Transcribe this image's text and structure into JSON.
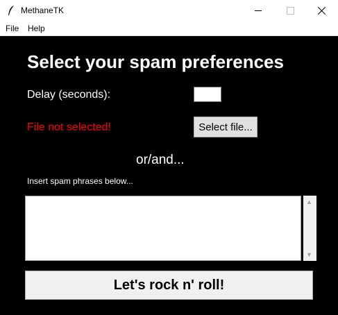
{
  "window": {
    "title": "MethaneTK"
  },
  "menu": {
    "items": [
      {
        "label": "File"
      },
      {
        "label": "Help"
      }
    ]
  },
  "main": {
    "heading": "Select your spam preferences",
    "delay_label": "Delay (seconds):",
    "delay_value": "",
    "file_status": "File not selected!",
    "select_file_label": "Select file...",
    "or_and": "or/and...",
    "insert_label": "Insert spam phrases below...",
    "phrases_value": "",
    "go_label": "Let's rock n' roll!"
  },
  "colors": {
    "background": "#000000",
    "text": "#ffffff",
    "error": "#ff0000"
  }
}
